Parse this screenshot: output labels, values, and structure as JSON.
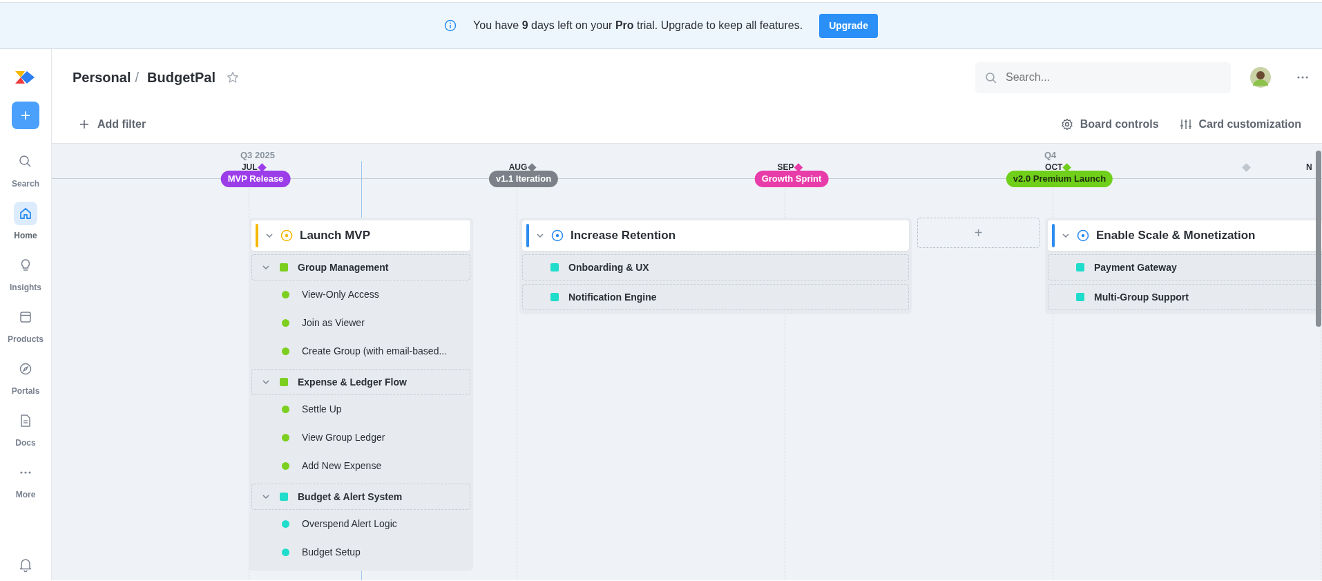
{
  "banner": {
    "text": "You have **9** days left on your **Pro** trial. Upgrade to keep all features.",
    "button": "Upgrade"
  },
  "sidebar": {
    "add_button": "+",
    "items": [
      {
        "label": "Search",
        "selected": false
      },
      {
        "label": "Home",
        "selected": true
      },
      {
        "label": "Insights",
        "selected": false
      },
      {
        "label": "Products",
        "selected": false
      },
      {
        "label": "Portals",
        "selected": false
      },
      {
        "label": "Docs",
        "selected": false
      },
      {
        "label": "More",
        "selected": false
      }
    ]
  },
  "header": {
    "breadcrumb": [
      "Personal",
      "/",
      "BudgetPal"
    ],
    "starred": false,
    "search": {
      "placeholder": "Search..."
    }
  },
  "toolbar": {
    "add_filter": "Add filter",
    "board_controls": "Board controls",
    "card_customization": "Card customization"
  },
  "timeline": {
    "months": [
      {
        "label": "JUL",
        "quarter": "Q3 2025",
        "milestone": {
          "label": "MVP Release",
          "color": "#9b3de8"
        }
      },
      {
        "label": "AUG",
        "milestone": {
          "label": "v1.1 Iteration",
          "color": "#7b8089"
        }
      },
      {
        "label": "SEP",
        "milestone": {
          "label": "Growth Sprint",
          "color": "#e83ca9"
        }
      },
      {
        "label": "OCT",
        "quarter": "Q4",
        "milestone": {
          "label": "v2.0 Premium Launch",
          "color": "#6fcf1a"
        }
      },
      {
        "label": "N"
      }
    ],
    "markers": [
      {
        "color": "#c0c6cd"
      }
    ]
  },
  "lanes": [
    {
      "kind": "initiative",
      "title": "Launch MVP",
      "color": "#f5b800",
      "expanded": true,
      "groups": [
        {
          "title": "Group Management",
          "color": "#7ccf1f",
          "expanded": true,
          "items": [
            {
              "label": "View-Only Access"
            },
            {
              "label": "Join as Viewer"
            },
            {
              "label": "Create Group (with email-based..."
            }
          ]
        },
        {
          "title": "Expense & Ledger Flow",
          "color": "#7ccf1f",
          "expanded": true,
          "items": [
            {
              "label": "Settle Up"
            },
            {
              "label": "View Group Ledger"
            },
            {
              "label": "Add New Expense"
            }
          ]
        },
        {
          "title": "Budget & Alert System",
          "color": "#1fdccb",
          "expanded": true,
          "items": [
            {
              "label": "Overspend Alert Logic"
            },
            {
              "label": "Budget Setup"
            }
          ]
        }
      ]
    },
    {
      "kind": "initiative",
      "title": "Increase Retention",
      "color": "#2d8cf0",
      "expanded": true,
      "groups": [
        {
          "title": "Onboarding & UX",
          "color": "#1fdccb"
        },
        {
          "title": "Notification Engine",
          "color": "#1fdccb"
        }
      ]
    },
    {
      "kind": "placeholder",
      "label": "+"
    },
    {
      "kind": "initiative",
      "title": "Enable Scale & Monetization",
      "color": "#2d8cf0",
      "expanded": true,
      "groups": [
        {
          "title": "Payment Gateway",
          "color": "#1fdccb"
        },
        {
          "title": "Multi-Group Support",
          "color": "#1fdccb"
        }
      ]
    }
  ]
}
